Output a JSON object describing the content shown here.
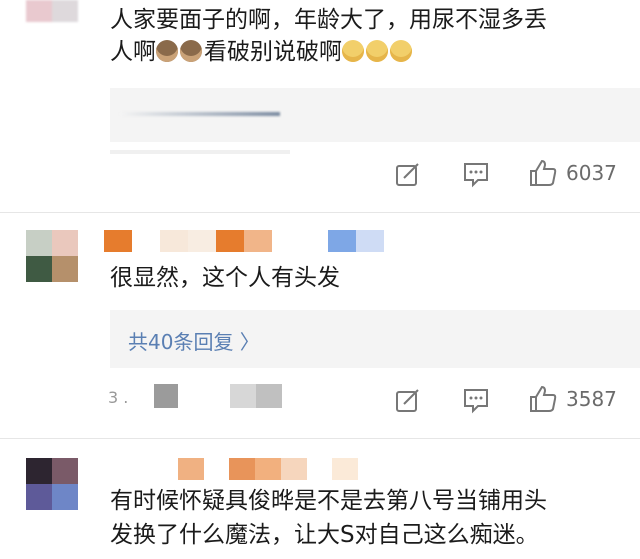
{
  "comments": [
    {
      "text_lines": [
        "人家要面子的啊，年龄大了，用尿不湿多丢",
        "人啊"
      ],
      "text_tail": "看破别说破啊",
      "actions": {
        "like_count": "6037"
      }
    },
    {
      "text_lines": [
        "很显然，这个人有头发"
      ],
      "reply_link": "共40条回复 〉",
      "actions": {
        "like_count": "3587"
      }
    },
    {
      "text_lines": [
        "有时候怀疑具俊晔是不是去第八号当铺用头",
        "发换了什么魔法，让大S对自己这么痴迷。"
      ]
    }
  ],
  "colors": {
    "text": "#1b1b1b",
    "meta": "#777777",
    "link": "#5a7fb3",
    "reply_bg": "#f4f4f4",
    "divider": "#e6e6e6"
  },
  "icons": [
    "share-icon",
    "comment-icon",
    "like-icon",
    "monkey-emoji-icon",
    "dog-emoji-icon",
    "chevron-right-icon"
  ]
}
